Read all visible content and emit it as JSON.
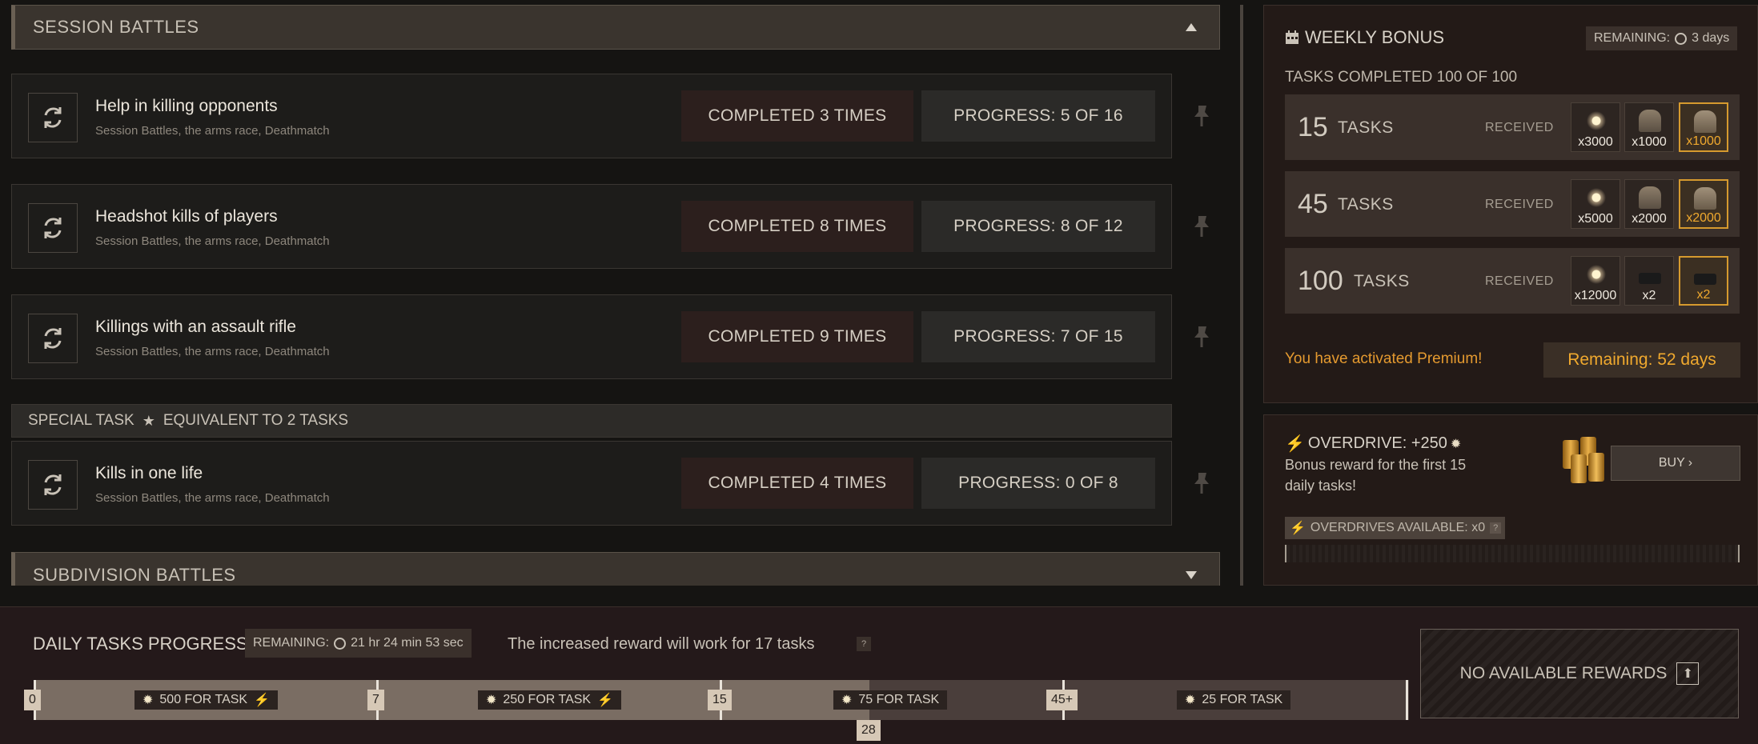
{
  "session": {
    "title": "SESSION BATTLES"
  },
  "tasks": [
    {
      "name": "Help in killing opponents",
      "sub": "Session Battles, the arms race, Deathmatch",
      "done": "COMPLETED 3 TIMES",
      "progress": "PROGRESS: 5 OF 16"
    },
    {
      "name": "Headshot kills of players",
      "sub": "Session Battles, the arms race, Deathmatch",
      "done": "COMPLETED 8 TIMES",
      "progress": "PROGRESS: 8 OF 12"
    },
    {
      "name": "Killings with an assault rifle",
      "sub": "Session Battles, the arms race, Deathmatch",
      "done": "COMPLETED 9 TIMES",
      "progress": "PROGRESS: 7 OF 15"
    },
    {
      "name": "Kills in one life",
      "sub": "Session Battles, the arms race, Deathmatch",
      "done": "COMPLETED 4 TIMES",
      "progress": "PROGRESS: 0 OF 8"
    }
  ],
  "special": {
    "label": "SPECIAL TASK",
    "equiv": "EQUIVALENT TO 2 TASKS"
  },
  "subdivision": {
    "title": "SUBDIVISION BATTLES"
  },
  "weekly": {
    "title": "WEEKLY BONUS",
    "remaining_label": "REMAINING:",
    "remaining_value": "3 days",
    "completed": "TASKS COMPLETED 100 OF 100",
    "rows": [
      {
        "count": "15",
        "label": "TASKS",
        "status": "RECEIVED",
        "rewards": [
          "x3000",
          "x1000",
          "x1000"
        ]
      },
      {
        "count": "45",
        "label": "TASKS",
        "status": "RECEIVED",
        "rewards": [
          "x5000",
          "x2000",
          "x2000"
        ]
      },
      {
        "count": "100",
        "label": "TASKS",
        "status": "RECEIVED",
        "rewards": [
          "x12000",
          "x2",
          "x2"
        ]
      }
    ],
    "premium": "You have activated Premium!",
    "premium_remaining": "Remaining: 52 days"
  },
  "overdrive": {
    "title": "OVERDRIVE: +250",
    "desc": "Bonus reward for the first 15 daily tasks!",
    "buy": "BUY",
    "available": "OVERDRIVES AVAILABLE: x0",
    "help": "?"
  },
  "daily": {
    "title": "DAILY TASKS PROGRESS",
    "remaining_label": "REMAINING:",
    "remaining_value": "21 hr 24 min 53 sec",
    "increased": "The increased reward will work for 17 tasks",
    "help": "?",
    "current": "28",
    "markers": [
      "0",
      "7",
      "15",
      "45+"
    ],
    "rewards": [
      "500 FOR TASK",
      "250 FOR TASK",
      "75 FOR TASK",
      "25 FOR TASK"
    ],
    "no_rewards": "NO AVAILABLE REWARDS"
  },
  "colors": {
    "accent_orange": "#e59a2f",
    "gold_border": "#d69a2e",
    "panel": "#231a17"
  }
}
